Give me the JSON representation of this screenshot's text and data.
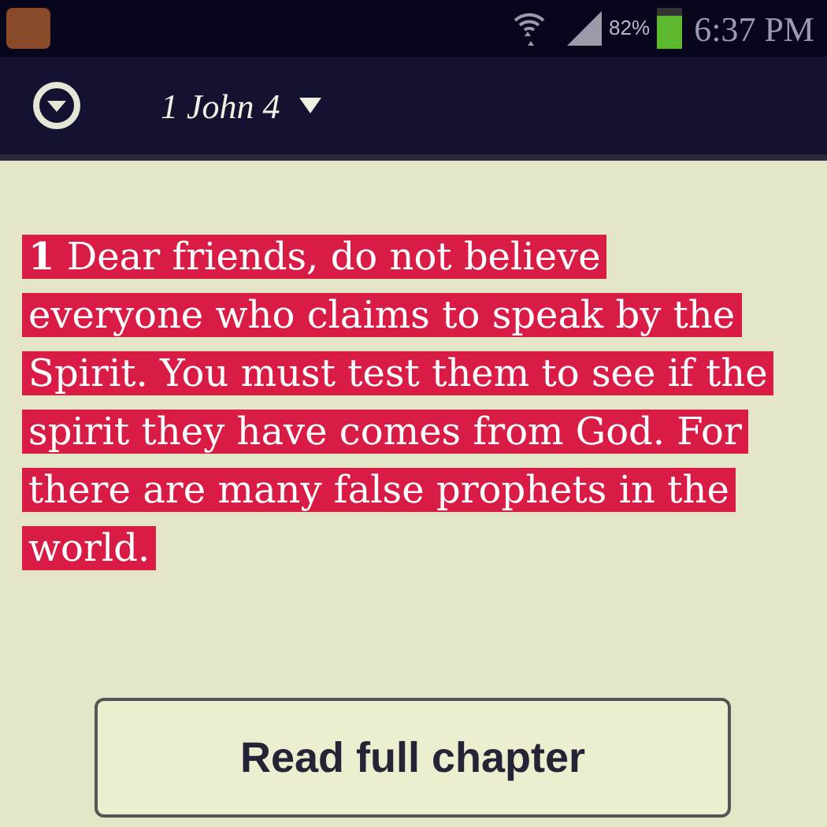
{
  "status_bar": {
    "battery": "82%",
    "time": "6:37 PM"
  },
  "header": {
    "title": "1 John 4"
  },
  "verse": {
    "text": "**1** Dear friends, do not believe everyone who claims to speak by the Spirit. You must test them to see if the spirit they have comes from God. For there are many false prophets in the world.",
    "highlighted": true
  },
  "button": {
    "label": "Read full chapter"
  }
}
